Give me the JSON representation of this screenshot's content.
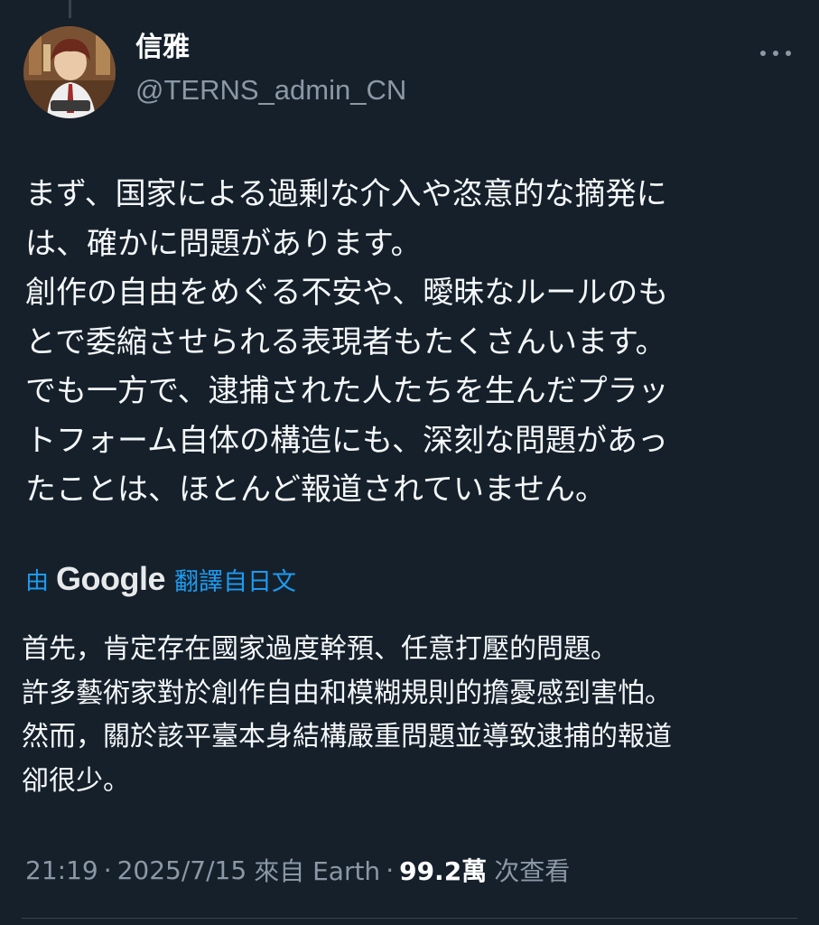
{
  "author": {
    "display_name": "信雅",
    "handle": "@TERNS_admin_CN"
  },
  "tweet": {
    "lines": [
      "まず、国家による過剰な介入や恣意的な摘発に",
      "は、確かに問題があります。",
      "創作の自由をめぐる不安や、曖昧なルールのも",
      "とで委縮させられる表現者もたくさんいます。",
      "でも一方で、逮捕された人たちを生んだプラッ",
      "トフォーム自体の構造にも、深刻な問題があっ",
      "たことは、ほとんど報道されていません。"
    ]
  },
  "translation": {
    "by_label": "由",
    "provider": "Google",
    "link_label": "翻譯自日文",
    "lines": [
      "首先，肯定存在國家過度幹預、任意打壓的問題。",
      "許多藝術家對於創作自由和模糊規則的擔憂感到害怕。",
      "然而，關於該平臺本身結構嚴重問題並導致逮捕的報道",
      "卻很少。"
    ]
  },
  "meta": {
    "time": "21:19",
    "separator": "·",
    "date": "2025/7/15",
    "source": "來自 Earth",
    "views_count": "99.2萬",
    "views_label": "次查看"
  },
  "icons": {
    "more": "more-horizontal-icon"
  },
  "colors": {
    "background": "#15202b",
    "accent": "#1d9bf0",
    "secondary_text": "#8b98a5"
  }
}
